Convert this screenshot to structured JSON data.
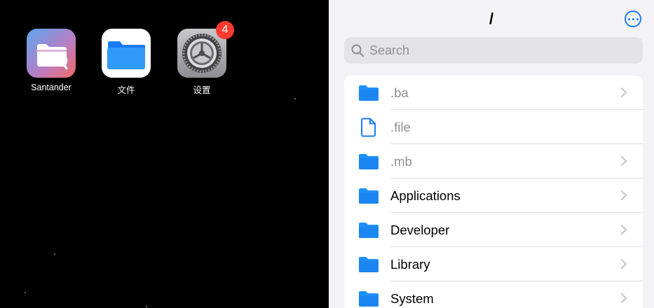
{
  "home": {
    "apps": [
      {
        "label": "Santander",
        "icon": "santander-folder-icon"
      },
      {
        "label": "文件",
        "icon": "files-folder-icon"
      },
      {
        "label": "设置",
        "icon": "settings-gear-icon",
        "badge": "4"
      }
    ]
  },
  "files": {
    "title": "/",
    "more_icon": "ellipsis-circle-icon",
    "search": {
      "placeholder": "Search",
      "value": ""
    },
    "items": [
      {
        "name": ".ba",
        "type": "folder",
        "hidden": true,
        "chevron": true
      },
      {
        "name": ".file",
        "type": "file",
        "hidden": true,
        "chevron": false
      },
      {
        "name": ".mb",
        "type": "folder",
        "hidden": true,
        "chevron": true
      },
      {
        "name": "Applications",
        "type": "folder",
        "hidden": false,
        "chevron": true
      },
      {
        "name": "Developer",
        "type": "folder",
        "hidden": false,
        "chevron": true
      },
      {
        "name": "Library",
        "type": "folder",
        "hidden": false,
        "chevron": true
      },
      {
        "name": "System",
        "type": "folder",
        "hidden": false,
        "chevron": true
      }
    ]
  },
  "colors": {
    "accent": "#1a7cf5",
    "badge": "#ff3b30",
    "folder": "#1e90ff"
  }
}
